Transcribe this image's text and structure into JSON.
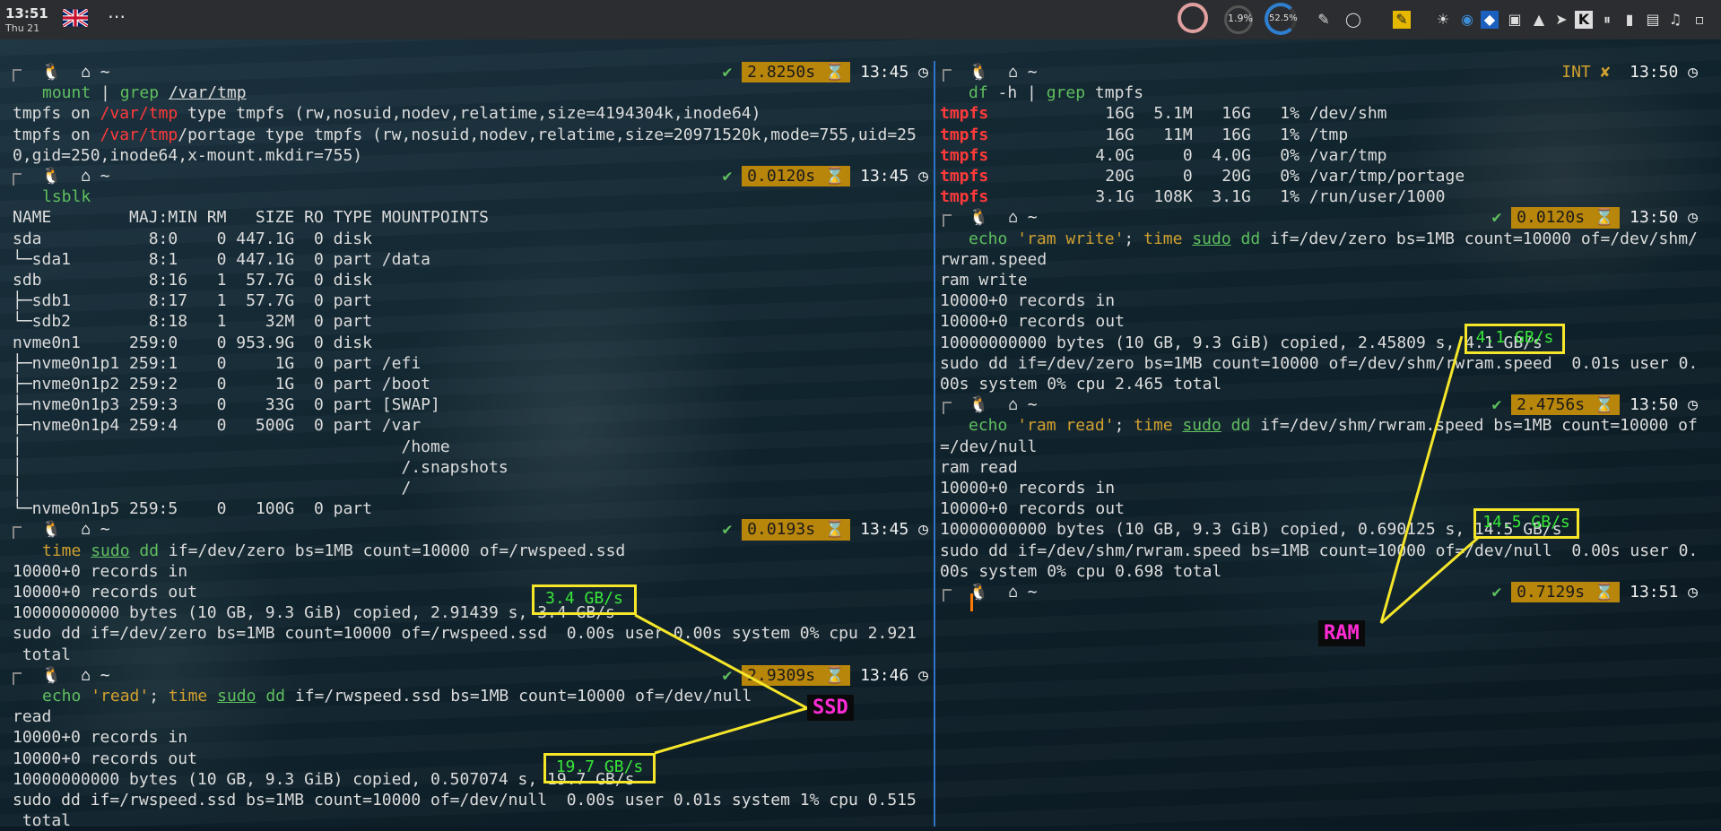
{
  "topbar": {
    "time": "13:51",
    "date": "Thu 21",
    "menu": "⋯",
    "cpu_percent": "1.9%",
    "mem_percent": "52.5%"
  },
  "left_pane": {
    "lines": [
      {
        "text": "mount | grep /var/tmp",
        "kind": "cmd"
      },
      {
        "text": "tmpfs on /var/tmp type tmpfs (rw,nosuid,nodev,relatime,size=4194304k,inode64)",
        "kind": "out"
      },
      {
        "text": "tmpfs on /var/tmp/portage type tmpfs (rw,nosuid,nodev,relatime,size=20971520k,mode=755,uid=25",
        "kind": "out"
      },
      {
        "text": "0,gid=250,inode64,x-mount.mkdir=755)",
        "kind": "out"
      },
      {
        "text": "lsblk",
        "kind": "cmd"
      },
      {
        "text": "NAME        MAJ:MIN RM   SIZE RO TYPE MOUNTPOINTS",
        "kind": "out"
      },
      {
        "text": "sda           8:0    0 447.1G  0 disk",
        "kind": "out"
      },
      {
        "text": "└─sda1        8:1    0 447.1G  0 part /data",
        "kind": "out"
      },
      {
        "text": "sdb           8:16   1  57.7G  0 disk",
        "kind": "out"
      },
      {
        "text": "├─sdb1        8:17   1  57.7G  0 part",
        "kind": "out"
      },
      {
        "text": "└─sdb2        8:18   1    32M  0 part",
        "kind": "out"
      },
      {
        "text": "nvme0n1     259:0    0 953.9G  0 disk",
        "kind": "out"
      },
      {
        "text": "├─nvme0n1p1 259:1    0     1G  0 part /efi",
        "kind": "out"
      },
      {
        "text": "├─nvme0n1p2 259:2    0     1G  0 part /boot",
        "kind": "out"
      },
      {
        "text": "├─nvme0n1p3 259:3    0    33G  0 part [SWAP]",
        "kind": "out"
      },
      {
        "text": "├─nvme0n1p4 259:4    0   500G  0 part /var",
        "kind": "out"
      },
      {
        "text": "│                                       /home",
        "kind": "out"
      },
      {
        "text": "│                                       /.snapshots",
        "kind": "out"
      },
      {
        "text": "│                                       /",
        "kind": "out"
      },
      {
        "text": "└─nvme0n1p5 259:5    0   100G  0 part",
        "kind": "out"
      },
      {
        "text": "time sudo dd if=/dev/zero bs=1MB count=10000 of=/rwspeed.ssd",
        "kind": "cmd"
      },
      {
        "text": "10000+0 records in",
        "kind": "out"
      },
      {
        "text": "10000+0 records out",
        "kind": "out"
      },
      {
        "text": "10000000000 bytes (10 GB, 9.3 GiB) copied, 2.91439 s, 3.4 GB/s",
        "kind": "out"
      },
      {
        "text": "sudo dd if=/dev/zero bs=1MB count=10000 of=/rwspeed.ssd  0.00s user 0.00s system 0% cpu 2.921",
        "kind": "out"
      },
      {
        "text": " total",
        "kind": "out"
      },
      {
        "text": "echo 'read'; time sudo dd if=/rwspeed.ssd bs=1MB count=10000 of=/dev/null",
        "kind": "cmd"
      },
      {
        "text": "read",
        "kind": "out"
      },
      {
        "text": "10000+0 records in",
        "kind": "out"
      },
      {
        "text": "10000+0 records out",
        "kind": "out"
      },
      {
        "text": "10000000000 bytes (10 GB, 9.3 GiB) copied, 0.507074 s, 19.7 GB/s",
        "kind": "out"
      },
      {
        "text": "sudo dd if=/rwspeed.ssd bs=1MB count=10000 of=/dev/null  0.00s user 0.01s system 1% cpu 0.515",
        "kind": "out"
      },
      {
        "text": " total",
        "kind": "out"
      }
    ],
    "statuses": [
      {
        "duration": "2.8250s",
        "time": "13:45"
      },
      {
        "duration": "0.0120s",
        "time": "13:45"
      },
      {
        "duration": "0.0193s",
        "time": "13:45"
      },
      {
        "duration": "2.9309s",
        "time": "13:46"
      }
    ],
    "highlights": [
      "3.4 GB/s",
      "19.7 GB/s"
    ],
    "label": "SSD"
  },
  "right_pane": {
    "lines": [
      {
        "text": "df -h | grep tmpfs",
        "kind": "cmd"
      },
      {
        "text": "tmpfs            16G  5.1M   16G   1% /dev/shm",
        "kind": "tmpfs"
      },
      {
        "text": "tmpfs            16G   11M   16G   1% /tmp",
        "kind": "tmpfs"
      },
      {
        "text": "tmpfs           4.0G     0  4.0G   0% /var/tmp",
        "kind": "tmpfs"
      },
      {
        "text": "tmpfs            20G     0   20G   0% /var/tmp/portage",
        "kind": "tmpfs"
      },
      {
        "text": "tmpfs           3.1G  108K  3.1G   1% /run/user/1000",
        "kind": "tmpfs"
      },
      {
        "text": "echo 'ram write'; time sudo dd if=/dev/zero bs=1MB count=10000 of=/dev/shm/",
        "kind": "cmd"
      },
      {
        "text": "rwram.speed",
        "kind": "out"
      },
      {
        "text": "ram write",
        "kind": "out"
      },
      {
        "text": "10000+0 records in",
        "kind": "out"
      },
      {
        "text": "10000+0 records out",
        "kind": "out"
      },
      {
        "text": "10000000000 bytes (10 GB, 9.3 GiB) copied, 2.45809 s, 4.1 GB/s",
        "kind": "out"
      },
      {
        "text": "sudo dd if=/dev/zero bs=1MB count=10000 of=/dev/shm/rwram.speed  0.01s user 0.",
        "kind": "out"
      },
      {
        "text": "00s system 0% cpu 2.465 total",
        "kind": "out"
      },
      {
        "text": "echo 'ram read'; time sudo dd if=/dev/shm/rwram.speed bs=1MB count=10000 of",
        "kind": "cmd"
      },
      {
        "text": "=/dev/null",
        "kind": "out"
      },
      {
        "text": "ram read",
        "kind": "out"
      },
      {
        "text": "10000+0 records in",
        "kind": "out"
      },
      {
        "text": "10000+0 records out",
        "kind": "out"
      },
      {
        "text": "10000000000 bytes (10 GB, 9.3 GiB) copied, 0.690125 s, 14.5 GB/s",
        "kind": "out"
      },
      {
        "text": "sudo dd if=/dev/shm/rwram.speed bs=1MB count=10000 of=/dev/null  0.00s user 0.",
        "kind": "out"
      },
      {
        "text": "00s system 0% cpu 0.698 total",
        "kind": "out"
      }
    ],
    "statuses": [
      {
        "duration": "INT ✘",
        "time": "13:50"
      },
      {
        "duration": "0.0120s",
        "time": "13:50"
      },
      {
        "duration": "2.4756s",
        "time": "13:50"
      },
      {
        "duration": "0.7129s",
        "time": "13:51"
      }
    ],
    "highlights": [
      "4.1 GB/s",
      "14.5 GB/s"
    ],
    "label": "RAM"
  },
  "prompt_symbols": {
    "tux": "🐧",
    "home": "⌂",
    "tilde": "~",
    "hourglass": "⌛",
    "clock": "◷",
    "check": "✔"
  },
  "colors": {
    "accent_duration": "#b8860b",
    "highlight_box": "#f5e62a",
    "label_text": "#ff2bd6",
    "tmpfs_red": "#ff3a3a",
    "command_green": "#5fbf5f",
    "divider": "#2f74c8"
  }
}
